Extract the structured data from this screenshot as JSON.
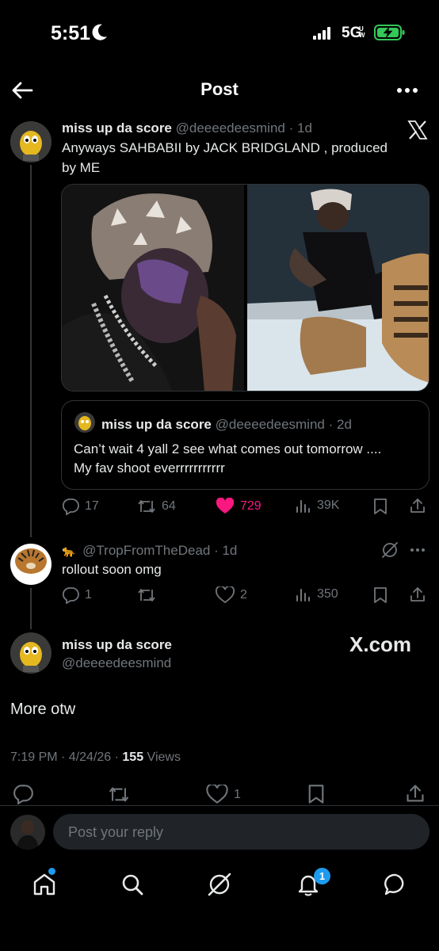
{
  "status": {
    "time": "5:51",
    "network": "5G",
    "network_sub": "UW"
  },
  "header": {
    "title": "Post"
  },
  "main_post": {
    "name": "miss up da score",
    "handle": "@deeeedeesmind",
    "time": "· 1d",
    "text_line1": "Anyways SAHBABII by JACK BRIDGLAND , produced",
    "text_line2": "by ME",
    "quote": {
      "name": "miss up da score",
      "handle": "@deeeedeesmind",
      "time": "· 2d",
      "text_line1": "Can’t wait 4 yall 2 see what comes out tomorrow ....",
      "text_line2": "My fav shoot everrrrrrrrrrr"
    },
    "actions": {
      "replies": "17",
      "reposts": "64",
      "likes": "729",
      "views": "39K"
    }
  },
  "reply_post": {
    "emoji": "🐆",
    "handle": "@TropFromTheDead",
    "time": "· 1d",
    "text": "rollout soon omg",
    "actions": {
      "replies": "1",
      "reposts": "",
      "likes": "2",
      "views": "350"
    }
  },
  "focus_post": {
    "name": "miss up da score",
    "handle": "@deeeedeesmind",
    "watermark": "X.com",
    "text": "More otw",
    "meta_time": "7:19 PM · 4/24/26 · ",
    "views_count": "155",
    "views_label": " Views",
    "actions": {
      "likes": "1"
    }
  },
  "reply_bar": {
    "placeholder": "Post your reply"
  },
  "bottom_nav": {
    "notifications_badge": "1"
  },
  "colors": {
    "background": "#000000",
    "like_pink": "#f91880",
    "muted": "#71767b",
    "accent": "#1d9bf0",
    "battery": "#34c759"
  }
}
